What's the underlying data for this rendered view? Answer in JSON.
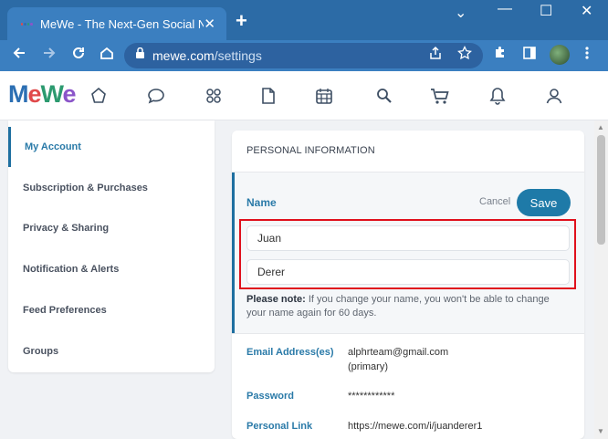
{
  "browser": {
    "tab_title": "MeWe - The Next-Gen Social Net",
    "tab_close": "✕",
    "new_tab": "+",
    "window_controls": {
      "chevron": "⌄",
      "minimize": "—",
      "maximize": "☐",
      "close": "✕"
    },
    "url_host": "mewe.com",
    "url_path": "/settings"
  },
  "app": {
    "logo": {
      "l1": "M",
      "l2": "e",
      "l3": "W",
      "l4": "e"
    },
    "nav_icons": [
      "home-icon",
      "chat-icon",
      "groups-icon",
      "pages-icon",
      "calendar-icon",
      "search-icon",
      "cart-icon",
      "bell-icon",
      "profile-icon"
    ]
  },
  "sidebar": {
    "items": [
      {
        "label": "My Account",
        "active": true
      },
      {
        "label": "Subscription & Purchases",
        "active": false
      },
      {
        "label": "Privacy & Sharing",
        "active": false
      },
      {
        "label": "Notification & Alerts",
        "active": false
      },
      {
        "label": "Feed Preferences",
        "active": false
      },
      {
        "label": "Groups",
        "active": false
      }
    ]
  },
  "personal": {
    "section_title": "PERSONAL INFORMATION",
    "name_label": "Name",
    "cancel_label": "Cancel",
    "save_label": "Save",
    "first_name": "Juan",
    "last_name": "Derer",
    "note_bold": "Please note:",
    "note_text": " If you change your name, you won't be able to change your name again for 60 days.",
    "email_label": "Email Address(es)",
    "email_value": "alphrteam@gmail.com",
    "email_sub": "(primary)",
    "password_label": "Password",
    "password_value": "************",
    "link_label": "Personal Link",
    "link_value": "https://mewe.com/i/juanderer1"
  },
  "colors": {
    "chrome": "#2c6ba6",
    "accent": "#1e7aa8",
    "highlight": "#e0101c"
  }
}
